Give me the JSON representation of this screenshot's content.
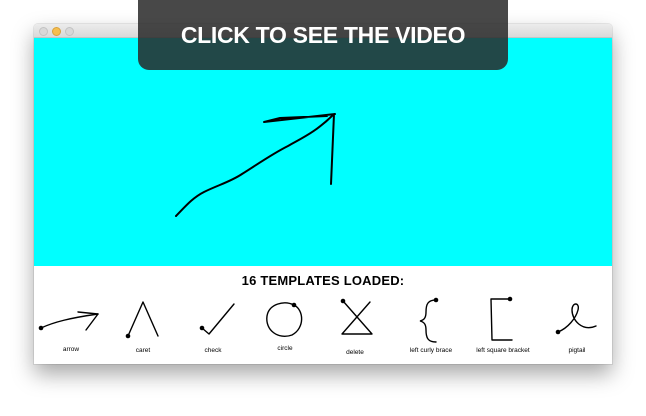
{
  "overlay": {
    "label": "CLICK TO SEE THE VIDEO"
  },
  "window": {
    "canvas_color": "#00ffff",
    "traffic_lights": [
      "close-button",
      "minimize-button",
      "maximize-button"
    ]
  },
  "panel": {
    "title": "16 TEMPLATES LOADED:",
    "templates": [
      {
        "label": "arrow"
      },
      {
        "label": "caret"
      },
      {
        "label": "check"
      },
      {
        "label": "circle"
      },
      {
        "label": "delete"
      },
      {
        "label": "left curly brace"
      },
      {
        "label": "left square bracket"
      },
      {
        "label": "pigtail"
      }
    ]
  },
  "colors": {
    "canvas": "#00ffff",
    "overlay": "#282828",
    "stroke": "#000000"
  }
}
